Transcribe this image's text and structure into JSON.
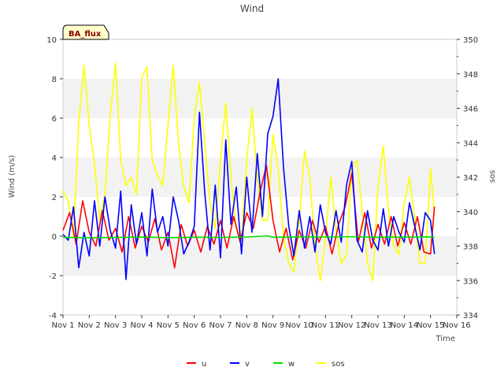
{
  "chart_data": {
    "type": "line",
    "title": "Wind",
    "badge": "BA_flux",
    "xlabel": "Time",
    "ylabel": "Wind (m/s)",
    "y2label": "sos",
    "ylim": [
      -4,
      10
    ],
    "y2lim": [
      334,
      350
    ],
    "xlim": [
      1,
      16
    ],
    "x_unit": "day of Nov",
    "x_ticks": [
      1,
      2,
      3,
      4,
      5,
      6,
      7,
      8,
      9,
      10,
      11,
      12,
      13,
      14,
      15,
      16
    ],
    "x_tick_labels": [
      "Nov 1",
      "Nov 2",
      "Nov 3",
      "Nov 4",
      "Nov 5",
      "Nov 6",
      "Nov 7",
      "Nov 8",
      "Nov 9",
      "Nov 10",
      "Nov 11",
      "Nov 12",
      "Nov 13",
      "Nov 14",
      "Nov 15",
      "Nov 16"
    ],
    "y_ticks": [
      -4,
      -2,
      0,
      2,
      4,
      6,
      8,
      10
    ],
    "y_tick_labels": [
      "-4",
      "-2",
      "0",
      "2",
      "4",
      "6",
      "8",
      "10"
    ],
    "y2_ticks": [
      334,
      336,
      338,
      340,
      342,
      344,
      346,
      348,
      350
    ],
    "y2_tick_labels": [
      "334",
      "336",
      "338",
      "340",
      "342",
      "344",
      "346",
      "348",
      "350"
    ],
    "bands": [
      [
        -2,
        0
      ],
      [
        2,
        4
      ],
      [
        6,
        8
      ]
    ],
    "band_color": "#f2f2f2",
    "legend": {
      "placement": "bottom-center",
      "entries": [
        "u",
        "v",
        "w",
        "sos"
      ]
    },
    "series": [
      {
        "name": "u",
        "axis": "left",
        "color": "#ff0000",
        "x": [
          1.0,
          1.25,
          1.5,
          1.75,
          2.0,
          2.25,
          2.5,
          2.75,
          3.0,
          3.25,
          3.5,
          3.75,
          4.0,
          4.25,
          4.5,
          4.75,
          5.0,
          5.25,
          5.5,
          5.75,
          6.0,
          6.25,
          6.5,
          6.75,
          7.0,
          7.25,
          7.5,
          7.75,
          8.0,
          8.25,
          8.5,
          8.75,
          9.0,
          9.25,
          9.5,
          9.75,
          10.0,
          10.25,
          10.5,
          10.75,
          11.0,
          11.25,
          11.5,
          11.75,
          12.0,
          12.25,
          12.5,
          12.75,
          13.0,
          13.25,
          13.5,
          13.75,
          14.0,
          14.25,
          14.5,
          14.75,
          15.0,
          15.15
        ],
        "values": [
          0.3,
          1.2,
          -0.4,
          1.8,
          0.2,
          -0.5,
          1.3,
          -0.2,
          0.4,
          -0.8,
          1.0,
          -0.6,
          0.5,
          -0.3,
          0.9,
          -0.7,
          0.2,
          -1.6,
          0.6,
          -0.5,
          0.3,
          -0.8,
          0.5,
          -0.4,
          0.8,
          -0.6,
          1.0,
          -0.3,
          1.2,
          0.4,
          2.2,
          3.6,
          0.8,
          -0.8,
          0.4,
          -1.2,
          0.3,
          -0.6,
          0.8,
          -0.3,
          0.5,
          -0.9,
          0.6,
          1.5,
          3.2,
          -0.3,
          1.2,
          -0.6,
          0.6,
          -0.4,
          1.0,
          -0.5,
          0.7,
          -0.4,
          1.0,
          -0.8,
          -0.9,
          1.5
        ]
      },
      {
        "name": "v",
        "axis": "left",
        "color": "#0000ff",
        "x": [
          1.0,
          1.2,
          1.4,
          1.6,
          1.8,
          2.0,
          2.2,
          2.4,
          2.6,
          2.8,
          3.0,
          3.2,
          3.4,
          3.6,
          3.8,
          4.0,
          4.2,
          4.4,
          4.6,
          4.8,
          5.0,
          5.2,
          5.4,
          5.6,
          5.8,
          6.0,
          6.2,
          6.4,
          6.6,
          6.8,
          7.0,
          7.2,
          7.4,
          7.6,
          7.8,
          8.0,
          8.2,
          8.4,
          8.6,
          8.8,
          9.0,
          9.2,
          9.4,
          9.6,
          9.8,
          10.0,
          10.2,
          10.4,
          10.6,
          10.8,
          11.0,
          11.2,
          11.4,
          11.6,
          11.8,
          12.0,
          12.2,
          12.4,
          12.6,
          12.8,
          13.0,
          13.2,
          13.4,
          13.6,
          13.8,
          14.0,
          14.2,
          14.4,
          14.6,
          14.8,
          15.0,
          15.15
        ],
        "values": [
          0.1,
          -0.2,
          1.5,
          -1.6,
          0.2,
          -1.0,
          1.8,
          -0.5,
          2.0,
          0.3,
          -0.6,
          2.3,
          -2.2,
          1.6,
          -0.4,
          1.2,
          -1.0,
          2.4,
          0.2,
          1.0,
          -0.5,
          2.0,
          0.8,
          -0.9,
          -0.3,
          0.5,
          6.3,
          2.2,
          -0.7,
          2.6,
          -1.1,
          4.9,
          0.6,
          2.5,
          -0.9,
          3.0,
          0.2,
          4.2,
          1.0,
          5.2,
          6.1,
          8.0,
          3.5,
          0.5,
          -1.0,
          1.3,
          -0.6,
          1.0,
          -0.8,
          1.6,
          0.2,
          -0.4,
          1.3,
          -0.3,
          2.6,
          3.8,
          -0.2,
          -0.8,
          1.3,
          -0.2,
          -0.7,
          1.4,
          -0.5,
          1.0,
          0.2,
          -0.3,
          1.7,
          0.5,
          -0.7,
          1.2,
          0.8,
          -0.9
        ]
      },
      {
        "name": "w",
        "axis": "left",
        "color": "#00dd00",
        "x": [
          1,
          2,
          3,
          4,
          5,
          6,
          7,
          8,
          8.8,
          9,
          10,
          11,
          12,
          13,
          14,
          15,
          15.15
        ],
        "values": [
          -0.05,
          -0.08,
          -0.06,
          -0.04,
          -0.07,
          -0.05,
          -0.06,
          -0.04,
          0.02,
          -0.05,
          -0.03,
          -0.04,
          -0.02,
          -0.05,
          -0.04,
          -0.03,
          -0.05
        ]
      },
      {
        "name": "sos",
        "axis": "right",
        "color": "#ffff00",
        "x": [
          1.0,
          1.2,
          1.4,
          1.6,
          1.8,
          2.0,
          2.2,
          2.4,
          2.6,
          2.8,
          3.0,
          3.2,
          3.4,
          3.6,
          3.8,
          4.0,
          4.2,
          4.4,
          4.6,
          4.8,
          5.0,
          5.2,
          5.4,
          5.6,
          5.8,
          6.0,
          6.2,
          6.4,
          6.6,
          6.8,
          7.0,
          7.2,
          7.4,
          7.6,
          7.8,
          8.0,
          8.2,
          8.4,
          8.6,
          8.8,
          9.0,
          9.2,
          9.4,
          9.6,
          9.8,
          10.0,
          10.2,
          10.4,
          10.6,
          10.8,
          11.0,
          11.2,
          11.4,
          11.6,
          11.8,
          12.0,
          12.2,
          12.4,
          12.6,
          12.8,
          13.0,
          13.2,
          13.4,
          13.6,
          13.8,
          14.0,
          14.2,
          14.4,
          14.6,
          14.8,
          15.0,
          15.15
        ],
        "values": [
          341.2,
          340.6,
          338.5,
          345.2,
          348.5,
          345.0,
          342.8,
          339.5,
          341.0,
          345.6,
          348.6,
          343.0,
          341.5,
          342.0,
          341.0,
          347.8,
          348.4,
          343.0,
          342.1,
          341.5,
          345.0,
          348.5,
          344.0,
          341.5,
          340.5,
          345.5,
          347.5,
          344.0,
          340.5,
          339.0,
          343.0,
          346.3,
          342.0,
          339.0,
          338.5,
          343.0,
          346.0,
          342.0,
          339.5,
          339.5,
          344.5,
          342.5,
          338.5,
          337.0,
          336.5,
          339.5,
          343.5,
          342.0,
          338.0,
          336.0,
          338.5,
          342.0,
          339.0,
          337.0,
          337.5,
          342.5,
          343.0,
          340.0,
          337.0,
          336.0,
          341.5,
          343.8,
          340.0,
          338.0,
          337.5,
          340.5,
          342.0,
          339.5,
          337.0,
          337.0,
          342.5,
          339.8
        ]
      }
    ]
  }
}
